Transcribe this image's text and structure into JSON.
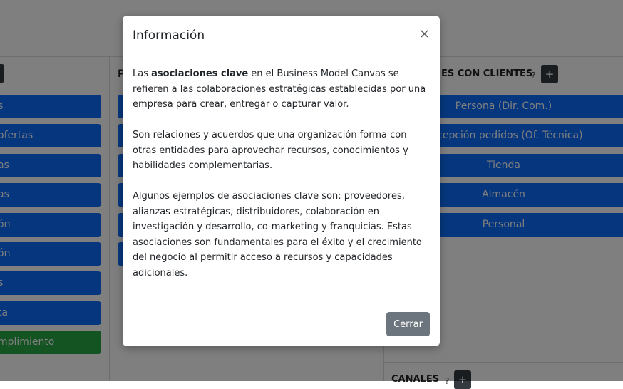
{
  "background": {
    "left_column": {
      "items": [
        {
          "label": "s",
          "color": "#0d6efd"
        },
        {
          "label": "ofertas",
          "color": "#0d6efd"
        },
        {
          "label": "as",
          "color": "#0d6efd"
        },
        {
          "label": "as",
          "color": "#0d6efd"
        },
        {
          "label": "ón",
          "color": "#0d6efd"
        },
        {
          "label": "ón",
          "color": "#0d6efd"
        },
        {
          "label": "s",
          "color": "#0d6efd"
        },
        {
          "label": "ta",
          "color": "#0d6efd"
        },
        {
          "label": "mplimiento",
          "color": "#28a745"
        }
      ]
    },
    "middle_column": {
      "title_fragment": "P"
    },
    "right_column": {
      "title": "ES CON CLIENTES",
      "help_label": "?",
      "add_label": "+",
      "items": [
        "Persona (Dir. Com.)",
        "Recepción pedidos (Of. Técnica)",
        "Tienda",
        "Almacén",
        "Personal"
      ],
      "bottom_title": "CANALES",
      "bottom_help_label": "?",
      "bottom_add_label": "+"
    }
  },
  "modal": {
    "title": "Información",
    "close_label": "×",
    "body": {
      "p1_prefix": "Las ",
      "p1_bold": "asociaciones clave",
      "p1_suffix": " en el Business Model Canvas se refieren a las colaboraciones estratégicas establecidas por una empresa para crear, entregar o capturar valor.",
      "p2": "Son relaciones y acuerdos que una organización forma con otras entidades para aprovechar recursos, conocimientos y habilidades complementarias.",
      "p3": "Algunos ejemplos de asociaciones clave son: proveedores, alianzas estratégicas, distribuidores, colaboración en investigación y desarrollo, co-marketing y franquicias. Estas asociaciones son fundamentales para el éxito y el crecimiento del negocio al permitir acceso a recursos y capacidades adicionales."
    },
    "footer_button": "Cerrar"
  },
  "colors": {
    "primary": "#0d6efd",
    "success": "#28a745",
    "dark": "#343a40",
    "secondary": "#6c757d"
  }
}
